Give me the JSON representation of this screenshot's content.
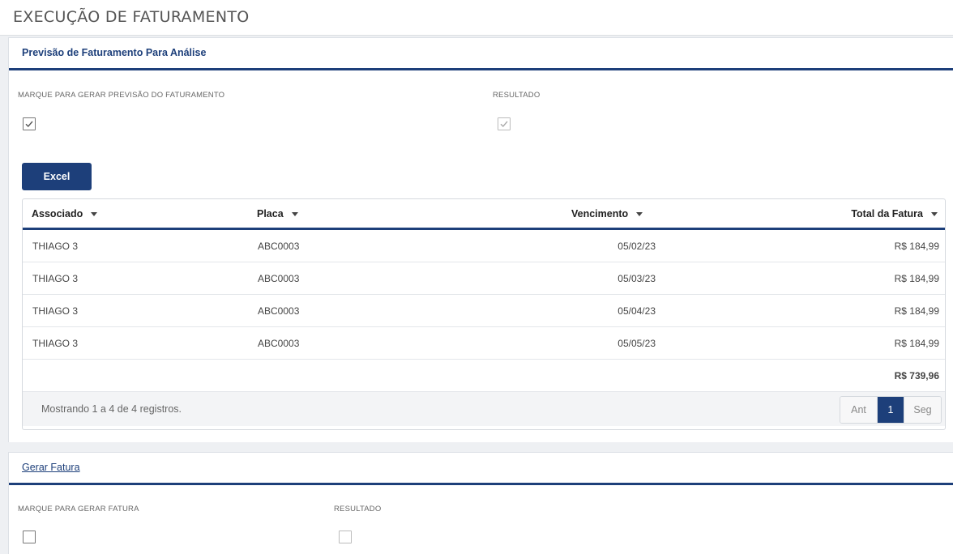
{
  "page": {
    "title": "EXECUÇÃO DE FATURAMENTO"
  },
  "previsao": {
    "title": "Previsão de Faturamento Para Análise",
    "check_label": "MARQUE PARA GERAR PREVISÃO DO FATURAMENTO",
    "check_checked": true,
    "result_label": "RESULTADO",
    "result_checked": true,
    "excel_label": "Excel",
    "columns": [
      "Associado",
      "Placa",
      "Vencimento",
      "Total da Fatura"
    ],
    "rows": [
      {
        "associado": "THIAGO 3",
        "placa": "ABC0003",
        "vencimento": "05/02/23",
        "total": "R$ 184,99"
      },
      {
        "associado": "THIAGO 3",
        "placa": "ABC0003",
        "vencimento": "05/03/23",
        "total": "R$ 184,99"
      },
      {
        "associado": "THIAGO 3",
        "placa": "ABC0003",
        "vencimento": "05/04/23",
        "total": "R$ 184,99"
      },
      {
        "associado": "THIAGO 3",
        "placa": "ABC0003",
        "vencimento": "05/05/23",
        "total": "R$ 184,99"
      }
    ],
    "grand_total": "R$ 739,96",
    "footer_info": "Mostrando 1 a 4 de 4 registros.",
    "pager": {
      "prev": "Ant",
      "current": "1",
      "next": "Seg"
    }
  },
  "fatura": {
    "title": "Gerar Fatura",
    "check_label": "MARQUE PARA GERAR FATURA",
    "check_checked": false,
    "result_label": "RESULTADO",
    "result_checked": false
  },
  "colors": {
    "primary": "#1d3f7a"
  },
  "icons": {
    "checkmark": "check-icon",
    "sort": "caret-down-icon"
  }
}
